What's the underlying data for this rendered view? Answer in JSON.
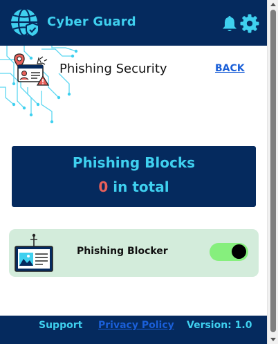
{
  "header": {
    "app_name": "Cyber Guard",
    "icons": [
      "globe-shield-logo",
      "bell-icon",
      "gear-icon"
    ]
  },
  "page": {
    "title": "Phishing Security",
    "back_label": "BACK"
  },
  "stats": {
    "title": "Phishing Blocks",
    "count": "0",
    "suffix": " in total"
  },
  "blocker": {
    "label": "Phishing Blocker",
    "enabled": true
  },
  "footer": {
    "support": "Support",
    "privacy": "Privacy Policy",
    "version": "Version: 1.0"
  },
  "colors": {
    "navy": "#052a5e",
    "cyan": "#3fd0ef",
    "link_blue": "#1a5fd8",
    "count_red": "#e8605a",
    "card_green": "#d3ecdb",
    "toggle_green": "#86ef7d"
  }
}
